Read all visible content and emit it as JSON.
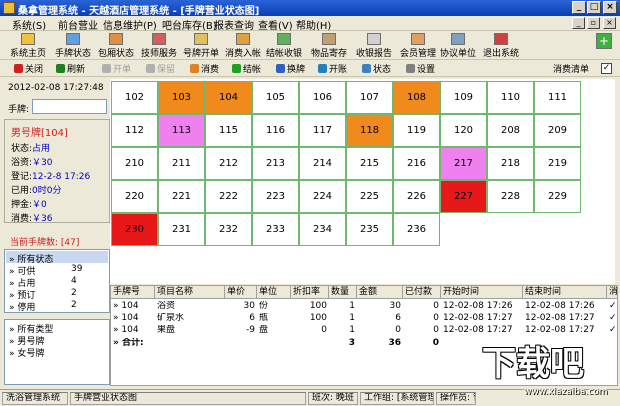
{
  "window": {
    "title": "桑拿管理系统 - 天越酒店管理系统 - [手牌营业状态图]"
  },
  "menu": [
    "系统(S)",
    "前台营业",
    "信息维护(P)",
    "吧台库存(B)",
    "报表查询",
    "查看(V)",
    "帮助(H)"
  ],
  "toolbar": [
    "系统主页",
    "手牌状态",
    "包厢状态",
    "技师服务",
    "号牌开单",
    "消费入帐",
    "结帐收银",
    "物品寄存",
    "收银报告",
    "会员管理",
    "协议单位",
    "退出系统"
  ],
  "actionbar": [
    "关闭",
    "刷新",
    "开单",
    "保留",
    "消费",
    "结帐",
    "换牌",
    "开账",
    "状态",
    "设置"
  ],
  "consume_list": {
    "label": "消费清单",
    "checked": "✓"
  },
  "left": {
    "datetime": "2012-02-08 17:27:48",
    "plate_label": "手牌:",
    "plate_value": "",
    "card_header": "男号牌[104]",
    "status_label": "状态:",
    "status_value": "占用",
    "bath_label": "浴资:",
    "bath_value": "￥30",
    "register_label": "登记:",
    "register_value": "12-2-8 17:26",
    "used_label": "已用:",
    "used_value": "0时0分",
    "deposit_label": "押金:",
    "deposit_value": "￥0",
    "consume_label": "消费:",
    "consume_value": "￥36",
    "current_count": "当前手牌数: [47]",
    "status_tree": [
      {
        "name": "所有状态",
        "value": ""
      },
      {
        "name": "可供",
        "value": "39"
      },
      {
        "name": "占用",
        "value": "4"
      },
      {
        "name": "预订",
        "value": "2"
      },
      {
        "name": "停用",
        "value": "2"
      }
    ],
    "type_tree": [
      "所有类型",
      "男号牌",
      "女号牌"
    ]
  },
  "room_colors": {
    "occupied": "#f08a1c",
    "reserved": "#f080f0",
    "disabled": "#e81818",
    "available": "#ffffff"
  },
  "rooms": [
    [
      {
        "n": "102",
        "s": "available"
      },
      {
        "n": "103",
        "s": "occupied"
      },
      {
        "n": "104",
        "s": "occupied"
      },
      {
        "n": "105",
        "s": "available"
      },
      {
        "n": "106",
        "s": "available"
      },
      {
        "n": "107",
        "s": "available"
      },
      {
        "n": "108",
        "s": "occupied"
      },
      {
        "n": "109",
        "s": "available"
      },
      {
        "n": "110",
        "s": "available"
      },
      {
        "n": "111",
        "s": "available"
      }
    ],
    [
      {
        "n": "112",
        "s": "available"
      },
      {
        "n": "113",
        "s": "reserved"
      },
      {
        "n": "115",
        "s": "available"
      },
      {
        "n": "116",
        "s": "available"
      },
      {
        "n": "117",
        "s": "available"
      },
      {
        "n": "118",
        "s": "occupied"
      },
      {
        "n": "119",
        "s": "available"
      },
      {
        "n": "120",
        "s": "available"
      },
      {
        "n": "208",
        "s": "available"
      },
      {
        "n": "209",
        "s": "available"
      }
    ],
    [
      {
        "n": "210",
        "s": "available"
      },
      {
        "n": "211",
        "s": "available"
      },
      {
        "n": "212",
        "s": "available"
      },
      {
        "n": "213",
        "s": "available"
      },
      {
        "n": "214",
        "s": "available"
      },
      {
        "n": "215",
        "s": "available"
      },
      {
        "n": "216",
        "s": "available"
      },
      {
        "n": "217",
        "s": "reserved"
      },
      {
        "n": "218",
        "s": "available"
      },
      {
        "n": "219",
        "s": "available"
      }
    ],
    [
      {
        "n": "220",
        "s": "available"
      },
      {
        "n": "221",
        "s": "available"
      },
      {
        "n": "222",
        "s": "available"
      },
      {
        "n": "223",
        "s": "available"
      },
      {
        "n": "224",
        "s": "available"
      },
      {
        "n": "225",
        "s": "available"
      },
      {
        "n": "226",
        "s": "available"
      },
      {
        "n": "227",
        "s": "disabled"
      },
      {
        "n": "228",
        "s": "available"
      },
      {
        "n": "229",
        "s": "available"
      }
    ],
    [
      {
        "n": "230",
        "s": "disabled"
      },
      {
        "n": "231",
        "s": "available"
      },
      {
        "n": "232",
        "s": "available"
      },
      {
        "n": "233",
        "s": "available"
      },
      {
        "n": "234",
        "s": "available"
      },
      {
        "n": "235",
        "s": "available"
      },
      {
        "n": "236",
        "s": "available"
      }
    ]
  ],
  "table": {
    "columns": [
      "手牌号",
      "项目名称",
      "单价",
      "单位",
      "折扣率",
      "数量",
      "金额",
      "已付款",
      "开始时间",
      "结束时间",
      "消"
    ],
    "rows": [
      [
        "104",
        "浴资",
        "30",
        "份",
        "100",
        "1",
        "30",
        "0",
        "12-02-08 17:26",
        "12-02-08 17:26",
        "✓"
      ],
      [
        "104",
        "矿泉水",
        "6",
        "瓶",
        "100",
        "1",
        "6",
        "0",
        "12-02-08 17:27",
        "12-02-08 17:27",
        "✓"
      ],
      [
        "104",
        "果盘",
        "-9",
        "盘",
        "0",
        "1",
        "0",
        "0",
        "12-02-08 17:27",
        "12-02-08 17:27",
        "✓"
      ]
    ],
    "total": {
      "label": "合计:",
      "qty": "3",
      "amount": "36",
      "paid": "0"
    }
  },
  "statusbar": [
    "洗浴管理系统",
    "手牌营业状态图",
    "班次: 晚班",
    "工作组: [系统管理]",
    "操作员: 管"
  ],
  "watermark": {
    "big": "下载吧",
    "small": "www.xiazaiba.com"
  }
}
